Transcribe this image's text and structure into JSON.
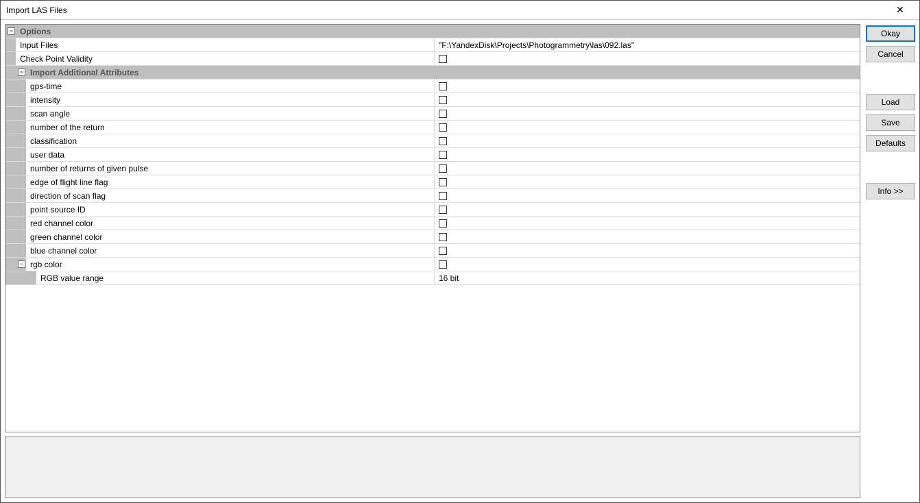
{
  "window": {
    "title": "Import LAS Files"
  },
  "buttons": {
    "okay": "Okay",
    "cancel": "Cancel",
    "load": "Load",
    "save": "Save",
    "defaults": "Defaults",
    "info": "Info >>"
  },
  "tree": {
    "options_header": "Options",
    "input_files": {
      "label": "Input Files",
      "value": "\"F:\\YandexDisk\\Projects\\Photogrammetry\\las\\092.las\""
    },
    "check_point_validity": {
      "label": "Check Point Validity",
      "checked": false
    },
    "import_attrs_header": "Import Additional Attributes",
    "attrs": [
      {
        "label": "gps-time",
        "checked": false
      },
      {
        "label": "intensity",
        "checked": false
      },
      {
        "label": "scan angle",
        "checked": false
      },
      {
        "label": "number of the return",
        "checked": false
      },
      {
        "label": "classification",
        "checked": false
      },
      {
        "label": "user data",
        "checked": false
      },
      {
        "label": "number of returns of given pulse",
        "checked": false
      },
      {
        "label": "edge of flight line flag",
        "checked": false
      },
      {
        "label": "direction of scan flag",
        "checked": false
      },
      {
        "label": "point source ID",
        "checked": false
      },
      {
        "label": "red channel color",
        "checked": false
      },
      {
        "label": "green channel color",
        "checked": false
      },
      {
        "label": "blue channel color",
        "checked": false
      }
    ],
    "rgb_color": {
      "label": "rgb color",
      "checked": false
    },
    "rgb_range": {
      "label": "RGB value range",
      "value": "16 bit"
    }
  },
  "layout": {
    "label_col_width": 611
  }
}
